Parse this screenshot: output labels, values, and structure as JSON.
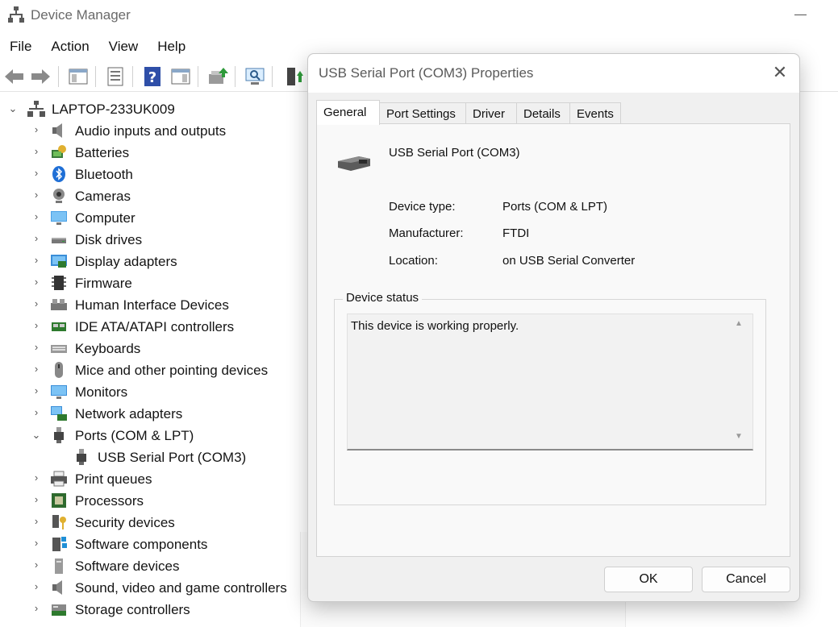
{
  "window": {
    "title": "Device Manager"
  },
  "menu": [
    "File",
    "Action",
    "View",
    "Help"
  ],
  "tree": {
    "root": "LAPTOP-233UK009",
    "items": [
      {
        "label": "Audio inputs and outputs",
        "icon": "speaker-icon"
      },
      {
        "label": "Batteries",
        "icon": "battery-icon"
      },
      {
        "label": "Bluetooth",
        "icon": "bluetooth-icon"
      },
      {
        "label": "Cameras",
        "icon": "camera-icon"
      },
      {
        "label": "Computer",
        "icon": "computer-icon"
      },
      {
        "label": "Disk drives",
        "icon": "disk-drive-icon"
      },
      {
        "label": "Display adapters",
        "icon": "display-adapter-icon"
      },
      {
        "label": "Firmware",
        "icon": "firmware-icon"
      },
      {
        "label": "Human Interface Devices",
        "icon": "hid-icon"
      },
      {
        "label": "IDE ATA/ATAPI controllers",
        "icon": "ide-controller-icon"
      },
      {
        "label": "Keyboards",
        "icon": "keyboard-icon"
      },
      {
        "label": "Mice and other pointing devices",
        "icon": "mouse-icon"
      },
      {
        "label": "Monitors",
        "icon": "monitor-icon"
      },
      {
        "label": "Network adapters",
        "icon": "network-adapter-icon"
      },
      {
        "label": "Ports (COM & LPT)",
        "icon": "port-icon"
      },
      {
        "label": "USB Serial Port (COM3)",
        "icon": "port-icon"
      },
      {
        "label": "Print queues",
        "icon": "printer-icon"
      },
      {
        "label": "Processors",
        "icon": "processor-icon"
      },
      {
        "label": "Security devices",
        "icon": "security-device-icon"
      },
      {
        "label": "Software components",
        "icon": "software-component-icon"
      },
      {
        "label": "Software devices",
        "icon": "software-device-icon"
      },
      {
        "label": "Sound, video and game controllers",
        "icon": "sound-controller-icon"
      },
      {
        "label": "Storage controllers",
        "icon": "storage-controller-icon"
      }
    ]
  },
  "dialog": {
    "title": "USB Serial Port (COM3) Properties",
    "tabs": [
      "General",
      "Port Settings",
      "Driver",
      "Details",
      "Events"
    ],
    "device_name": "USB Serial Port (COM3)",
    "props": [
      {
        "label": "Device type:",
        "value": "Ports (COM & LPT)"
      },
      {
        "label": "Manufacturer:",
        "value": "FTDI"
      },
      {
        "label": "Location:",
        "value": "on USB Serial Converter"
      }
    ],
    "status_group": "Device status",
    "status_text": "This device is working properly.",
    "ok": "OK",
    "cancel": "Cancel"
  }
}
